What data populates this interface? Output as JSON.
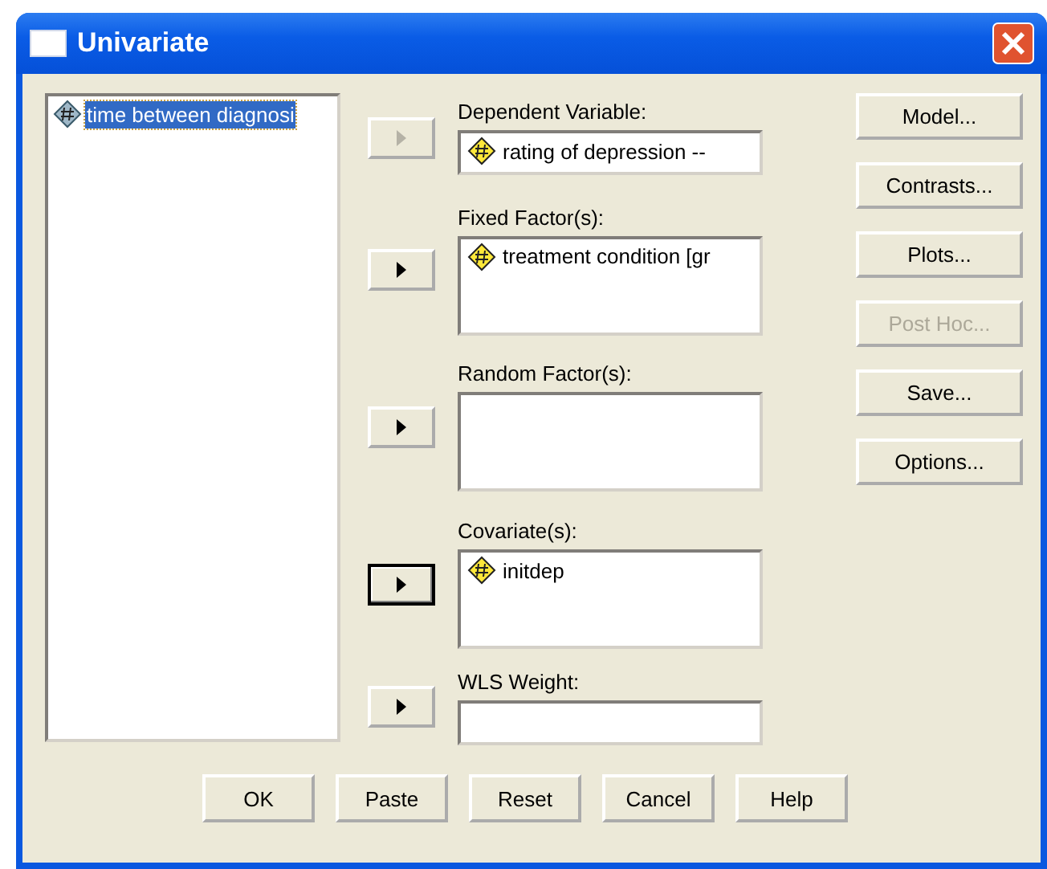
{
  "window": {
    "title": "Univariate"
  },
  "source_list": {
    "items": [
      {
        "label": "time between diagnosi",
        "selected": true
      }
    ]
  },
  "targets": [
    {
      "label": "Dependent Variable:",
      "kind": "single",
      "arrow_disabled": true,
      "arrow_default": false,
      "items": [
        "rating of depression --"
      ]
    },
    {
      "label": "Fixed Factor(s):",
      "kind": "list",
      "arrow_disabled": false,
      "arrow_default": false,
      "items": [
        "treatment condition [gr"
      ]
    },
    {
      "label": "Random Factor(s):",
      "kind": "list",
      "arrow_disabled": false,
      "arrow_default": false
    },
    {
      "label": "Covariate(s):",
      "kind": "list",
      "arrow_disabled": false,
      "arrow_default": true,
      "items": [
        "initdep"
      ]
    },
    {
      "label": "WLS Weight:",
      "kind": "single",
      "arrow_disabled": false,
      "arrow_default": false
    }
  ],
  "side_buttons": [
    {
      "label": "Model...",
      "disabled": false
    },
    {
      "label": "Contrasts...",
      "disabled": false
    },
    {
      "label": "Plots...",
      "disabled": false
    },
    {
      "label": "Post Hoc...",
      "disabled": true
    },
    {
      "label": "Save...",
      "disabled": false
    },
    {
      "label": "Options...",
      "disabled": false
    }
  ],
  "bottom_buttons": [
    "OK",
    "Paste",
    "Reset",
    "Cancel",
    "Help"
  ]
}
